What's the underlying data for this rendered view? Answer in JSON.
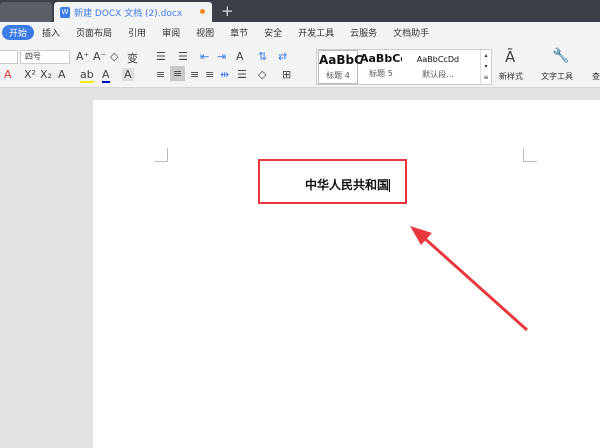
{
  "tabs": {
    "document_title": "新建 DOCX 文档 (2).docx",
    "new_tab": "+"
  },
  "menu": [
    "开始",
    "插入",
    "页面布局",
    "引用",
    "审阅",
    "视图",
    "章节",
    "安全",
    "开发工具",
    "云服务",
    "文档助手"
  ],
  "ribbon": {
    "font_size": "四号",
    "styles": [
      {
        "preview": "AaBbC",
        "name": "标题 4"
      },
      {
        "preview": "AaBbCc",
        "name": "标题 5"
      },
      {
        "preview": "AaBbCcDd",
        "name": "默认段..."
      }
    ],
    "new_style": "新样式",
    "text_tools": "文字工具",
    "find": "查"
  },
  "document": {
    "text": "中华人民共和国"
  },
  "colors": {
    "accent": "#3d7be8",
    "highlight_box": "#e8383d"
  }
}
